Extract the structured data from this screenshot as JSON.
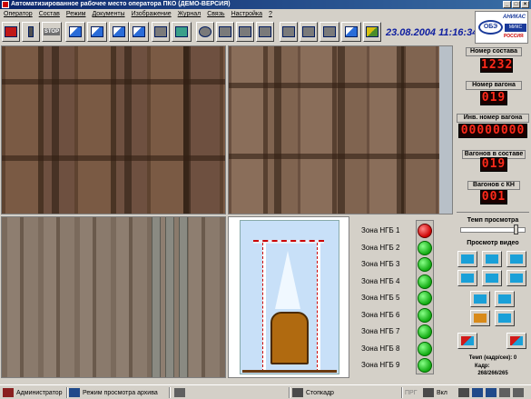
{
  "window": {
    "title": "Автоматизированное рабочее место оператора ПКО (ДЕМО-ВЕРСИЯ)"
  },
  "menu": [
    "Оператор",
    "Состав",
    "Режим",
    "Документы",
    "Изображение",
    "Журнал",
    "Связь",
    "Настройка",
    "?"
  ],
  "toolbar": {
    "buttons": [
      "train-icon",
      "traffic-light-icon",
      "stop-icon",
      "camera-view-1-icon",
      "camera-view-2-icon",
      "camera-view-3-icon",
      "camera-view-4-icon",
      "print-icon",
      "capture-icon",
      "zoom-icon",
      "grid-icon",
      "filter-icon",
      "network-icon",
      "monitor-icon",
      "computer-icon",
      "display-icon",
      "eye-icon",
      "exit-icon"
    ],
    "stop_label": "STOP",
    "datetime": "23.08.2004 11:16:34"
  },
  "logo": {
    "company": "АНИКАС",
    "mark": "ОБЭ",
    "sub": "МИКС",
    "country": "РОССИЯ"
  },
  "right_panel": {
    "train_number_label": "Номер состава",
    "train_number": "1232",
    "wagon_number_label": "Номер вагона",
    "wagon_number": "019",
    "inv_number_label": "Инв. номер вагона",
    "inv_number": "00000000",
    "wagons_in_train_label": "Вагонов в составе",
    "wagons_in_train": "019",
    "wagons_kn_label": "Вагонов с КН",
    "wagons_kn": "001",
    "view_rate_label": "Темп просмотра",
    "view_rate_level": 0.85,
    "video_label": "Просмотр видео",
    "video_buttons": [
      "rewind-start-icon",
      "play-icon",
      "forward-icon",
      "step-back-icon",
      "frame-icon",
      "step-forward-icon",
      "prev-frame-icon",
      "next-frame-icon",
      "back-arrow-icon",
      "forward-arrow-icon",
      "record-back-icon",
      "record-forward-icon"
    ],
    "fps_label": "Темп (кадр/сек):",
    "fps_value": "0",
    "frame_label": "Кадр:",
    "frame_value": "268/266/265"
  },
  "zones": [
    {
      "name": "Зона НГБ 1",
      "status": "red"
    },
    {
      "name": "Зона НГБ 2",
      "status": "green"
    },
    {
      "name": "Зона НГБ 3",
      "status": "green"
    },
    {
      "name": "Зона НГБ 4",
      "status": "green"
    },
    {
      "name": "Зона НГБ 5",
      "status": "green"
    },
    {
      "name": "Зона НГБ 6",
      "status": "green"
    },
    {
      "name": "Зона НГБ 7",
      "status": "green"
    },
    {
      "name": "Зона НГБ 8",
      "status": "green"
    },
    {
      "name": "Зона НГБ 9",
      "status": "green"
    }
  ],
  "status": {
    "user": "Администратор",
    "mode": "Режим просмотра архива",
    "stopframe": "Стопкадр",
    "prg": "ПРГ",
    "vkl": "Вкл"
  }
}
